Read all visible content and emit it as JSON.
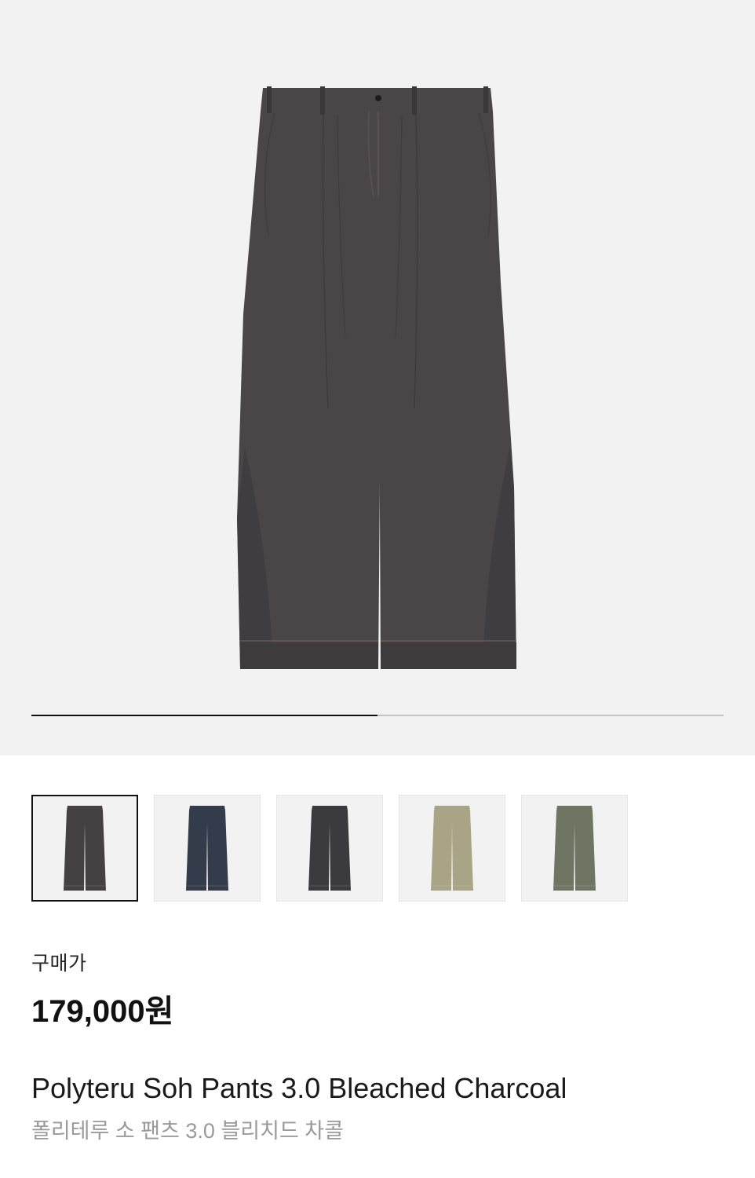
{
  "gallery": {
    "progress_fraction": 0.5,
    "main_image": {
      "icon": "wide-pleated-pants-image",
      "color": "#4a4647"
    }
  },
  "colors": {
    "hero_bg": "#f2f2f2",
    "progress_fill": "#111111",
    "progress_track": "#c4c4c4"
  },
  "variants": [
    {
      "icon": "pants-variant-bleached-charcoal",
      "color": "#454143",
      "selected": true
    },
    {
      "icon": "pants-variant-navy",
      "color": "#343b4a",
      "selected": false
    },
    {
      "icon": "pants-variant-charcoal",
      "color": "#3b3b3f",
      "selected": false
    },
    {
      "icon": "pants-variant-beige",
      "color": "#a9a486",
      "selected": false
    },
    {
      "icon": "pants-variant-olive",
      "color": "#6f7563",
      "selected": false
    }
  ],
  "price": {
    "label": "구매가",
    "value": "179,000원"
  },
  "product": {
    "name_en": "Polyteru Soh Pants 3.0 Bleached Charcoal",
    "name_ko": "폴리테루 소 팬츠 3.0 블리치드 차콜"
  }
}
